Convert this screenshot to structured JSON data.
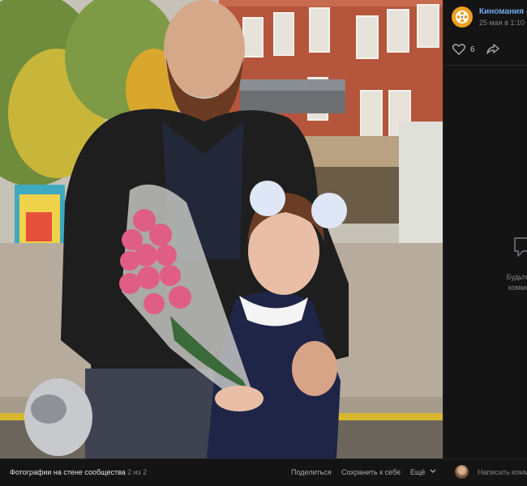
{
  "post": {
    "author": "Киномания - Л",
    "date": "25 мая в 1:10",
    "likes_count": "6"
  },
  "comments": {
    "empty_line1": "Будьте среди пер",
    "empty_line2": "комментарий к з"
  },
  "footer": {
    "caption": "Фотографии на стене сообщества",
    "counter": "2 из 2",
    "share_label": "Поделиться",
    "save_label": "Сохранить к себе",
    "more_label": "Ещё",
    "comment_placeholder": "Написать комм"
  },
  "icons": {
    "author_avatar": "film-reel-icon",
    "like": "heart-icon",
    "share": "share-arrow-icon",
    "comment": "comment-bubble-icon",
    "more": "chevron-down-icon"
  },
  "colors": {
    "background": "#0a0a0a",
    "panel": "#141414",
    "link": "#71aaeb",
    "avatar": "#f0a01e",
    "muted": "#828282"
  }
}
